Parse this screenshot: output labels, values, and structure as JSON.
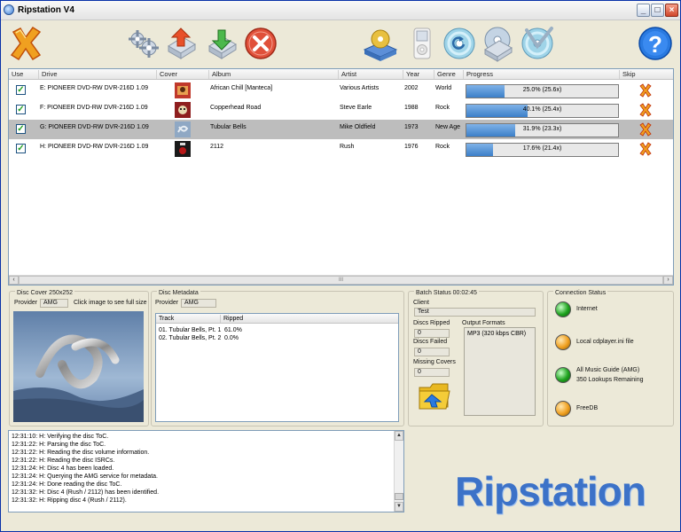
{
  "window": {
    "title": "Ripstation V4",
    "controls": [
      "_",
      "□",
      "×"
    ]
  },
  "toolbar": {
    "icons": [
      "exit-icon",
      "settings-icon",
      "upload-icon",
      "download-icon",
      "stop-icon",
      "scanner-icon",
      "ipod-icon",
      "disc-refresh-icon",
      "disc-download-icon",
      "disc-check-icon",
      "help-icon"
    ]
  },
  "grid": {
    "columns": [
      "Use",
      "Drive",
      "Cover",
      "Album",
      "Artist",
      "Year",
      "Genre",
      "Progress",
      "Skip"
    ],
    "rows": [
      {
        "use": true,
        "drive": "E: PIONEER  DVD-RW  DVR-216D 1.09",
        "album": "African Chill [Manteca]",
        "artist": "Various Artists",
        "year": "2002",
        "genre": "World",
        "progress": 0.25,
        "progress_text": "25.0% (25.6x)",
        "selected": false,
        "cover_color": "#c0392b"
      },
      {
        "use": true,
        "drive": "F: PIONEER  DVD-RW  DVR-216D 1.09",
        "album": "Copperhead Road",
        "artist": "Steve Earle",
        "year": "1988",
        "genre": "Rock",
        "progress": 0.401,
        "progress_text": "40.1% (25.4x)",
        "selected": false,
        "cover_color": "#8e1e1e"
      },
      {
        "use": true,
        "drive": "G: PIONEER  DVD-RW  DVR-216D 1.09",
        "album": "Tubular Bells",
        "artist": "Mike Oldfield",
        "year": "1973",
        "genre": "New Age",
        "progress": 0.319,
        "progress_text": "31.9% (23.3x)",
        "selected": true,
        "cover_color": "#6a7f9a"
      },
      {
        "use": true,
        "drive": "H: PIONEER  DVD-RW  DVR-216D 1.09",
        "album": "2112",
        "artist": "Rush",
        "year": "1976",
        "genre": "Rock",
        "progress": 0.176,
        "progress_text": "17.6% (21.4x)",
        "selected": false,
        "cover_color": "#1a1a1a"
      }
    ],
    "scroll_thumb": "III"
  },
  "disc_cover": {
    "title": "Disc Cover 250x252",
    "provider_label": "Provider",
    "provider": "AMG",
    "hint": "Click image to see full size"
  },
  "disc_metadata": {
    "title": "Disc Metadata",
    "provider_label": "Provider",
    "provider": "AMG",
    "columns": [
      "Track",
      "Ripped"
    ],
    "tracks": [
      {
        "track": "01. Tubular Bells, Pt. 1",
        "ripped": "61.0%"
      },
      {
        "track": "02. Tubular Bells, Pt. 2",
        "ripped": "0.0%"
      }
    ]
  },
  "batch": {
    "title": "Batch Status 00:02:45",
    "client_label": "Client",
    "client": "Test",
    "ripped_label": "Discs Ripped",
    "ripped": "0",
    "failed_label": "Discs Failed",
    "failed": "0",
    "missing_label": "Missing Covers",
    "missing": "0",
    "formats_label": "Output Formats",
    "formats": "MP3 (320 kbps CBR)"
  },
  "connection": {
    "title": "Connection Status",
    "items": [
      {
        "label": "Internet",
        "label2": "",
        "status": "green"
      },
      {
        "label": "Local cdplayer.ini file",
        "label2": "",
        "status": "orange"
      },
      {
        "label": "All Music Guide (AMG)",
        "label2": "350 Lookups Remaining",
        "status": "green"
      },
      {
        "label": "FreeDB",
        "label2": "",
        "status": "orange"
      }
    ]
  },
  "log": {
    "lines": [
      "12:31:10: H: Verifying the disc ToC.",
      "12:31:22: H: Parsing the disc ToC.",
      "12:31:22: H: Reading the disc volume information.",
      "12:31:22: H: Reading the disc ISRCs.",
      "12:31:24: H: Disc 4 has been loaded.",
      "12:31:24: H: Querying the AMG service for metadata.",
      "12:31:24: H: Done reading the disc ToC.",
      "12:31:32: H: Disc 4 (Rush / 2112) has been identified.",
      "12:31:32: H: Ripping disc 4 (Rush / 2112)."
    ]
  },
  "brand": "Ripstation",
  "colors": {
    "accent": "#3c72c8",
    "progress": "#3c7fc8",
    "selected_row": "#bdbdbd"
  }
}
